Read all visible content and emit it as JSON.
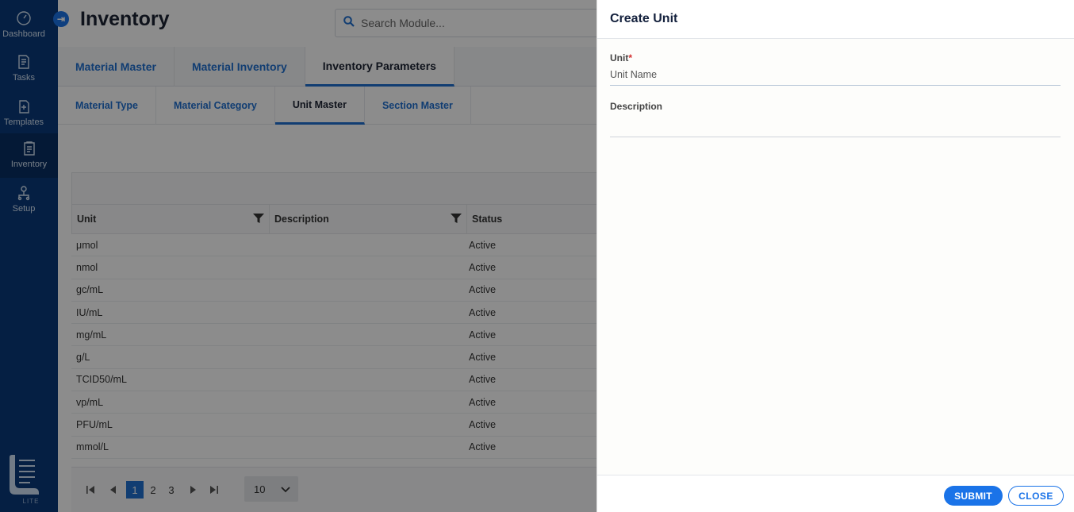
{
  "sidebar": {
    "items": [
      {
        "label": "Dashboard",
        "icon": "gauge-icon"
      },
      {
        "label": "Tasks",
        "icon": "tasks-icon"
      },
      {
        "label": "Templates",
        "icon": "templates-icon"
      },
      {
        "label": "Inventory",
        "icon": "inventory-icon",
        "active": true
      },
      {
        "label": "Setup",
        "icon": "setup-icon"
      }
    ],
    "logo_caption": "LITE"
  },
  "header": {
    "title": "Inventory",
    "search_placeholder": "Search Module..."
  },
  "main_tabs": [
    {
      "label": "Material Master"
    },
    {
      "label": "Material Inventory"
    },
    {
      "label": "Inventory Parameters",
      "active": true
    }
  ],
  "sub_tabs": [
    {
      "label": "Material Type"
    },
    {
      "label": "Material Category"
    },
    {
      "label": "Unit Master",
      "active": true
    },
    {
      "label": "Section Master"
    }
  ],
  "grid": {
    "columns": [
      "Unit",
      "Description",
      "Status"
    ],
    "rows": [
      {
        "unit": "μmol",
        "description": "",
        "status": "Active"
      },
      {
        "unit": "nmol",
        "description": "",
        "status": "Active"
      },
      {
        "unit": "gc/mL",
        "description": "",
        "status": "Active"
      },
      {
        "unit": "IU/mL",
        "description": "",
        "status": "Active"
      },
      {
        "unit": "mg/mL",
        "description": "",
        "status": "Active"
      },
      {
        "unit": "g/L",
        "description": "",
        "status": "Active"
      },
      {
        "unit": "TCID50/mL",
        "description": "",
        "status": "Active"
      },
      {
        "unit": "vp/mL",
        "description": "",
        "status": "Active"
      },
      {
        "unit": "PFU/mL",
        "description": "",
        "status": "Active"
      },
      {
        "unit": "mmol/L",
        "description": "",
        "status": "Active"
      }
    ],
    "pager": {
      "pages": [
        "1",
        "2",
        "3"
      ],
      "current": "1",
      "page_size": "10"
    }
  },
  "drawer": {
    "title": "Create Unit",
    "unit_label": "Unit",
    "required_mark": "*",
    "unit_placeholder": "Unit Name",
    "description_label": "Description",
    "description_value": "",
    "submit_label": "SUBMIT",
    "close_label": "CLOSE"
  },
  "colors": {
    "sidebar": "#0a3a7a",
    "accent": "#1a73e8",
    "required": "#d32f2f"
  }
}
